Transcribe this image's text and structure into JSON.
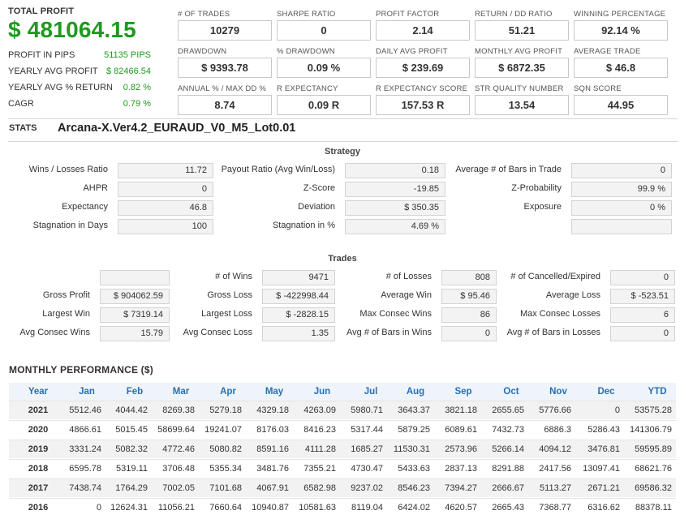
{
  "summary": {
    "total_profit_label": "TOTAL PROFIT",
    "total_profit_value": "$ 481064.15",
    "rows": [
      {
        "label": "PROFIT IN PIPS",
        "value": "51135 PIPS"
      },
      {
        "label": "YEARLY AVG PROFIT",
        "value": "$ 82466.54"
      },
      {
        "label": "YEARLY AVG % RETURN",
        "value": "0.82 %"
      },
      {
        "label": "CAGR",
        "value": "0.79 %"
      }
    ]
  },
  "metrics": [
    {
      "label": "# OF TRADES",
      "value": "10279"
    },
    {
      "label": "SHARPE RATIO",
      "value": "0"
    },
    {
      "label": "PROFIT FACTOR",
      "value": "2.14"
    },
    {
      "label": "RETURN / DD RATIO",
      "value": "51.21"
    },
    {
      "label": "WINNING PERCENTAGE",
      "value": "92.14 %"
    },
    {
      "label": "DRAWDOWN",
      "value": "$ 9393.78"
    },
    {
      "label": "% DRAWDOWN",
      "value": "0.09 %"
    },
    {
      "label": "DAILY AVG PROFIT",
      "value": "$ 239.69"
    },
    {
      "label": "MONTHLY AVG PROFIT",
      "value": "$ 6872.35"
    },
    {
      "label": "AVERAGE TRADE",
      "value": "$ 46.8"
    },
    {
      "label": "ANNUAL % / MAX DD %",
      "value": "8.74"
    },
    {
      "label": "R EXPECTANCY",
      "value": "0.09 R"
    },
    {
      "label": "R EXPECTANCY SCORE",
      "value": "157.53 R"
    },
    {
      "label": "STR QUALITY NUMBER",
      "value": "13.54"
    },
    {
      "label": "SQN SCORE",
      "value": "44.95"
    }
  ],
  "stats": {
    "label": "STATS",
    "strategy_name": "Arcana-X.Ver4.2_EURAUD_V0_M5_Lot0.01"
  },
  "strategy": {
    "title": "Strategy",
    "rows": [
      [
        {
          "label": "Wins / Losses Ratio",
          "value": "11.72"
        },
        {
          "label": "Payout Ratio (Avg Win/Loss)",
          "value": "0.18"
        },
        {
          "label": "Average # of Bars in Trade",
          "value": "0"
        }
      ],
      [
        {
          "label": "AHPR",
          "value": "0"
        },
        {
          "label": "Z-Score",
          "value": "-19.85"
        },
        {
          "label": "Z-Probability",
          "value": "99.9 %"
        }
      ],
      [
        {
          "label": "Expectancy",
          "value": "46.8"
        },
        {
          "label": "Deviation",
          "value": "$ 350.35"
        },
        {
          "label": "Exposure",
          "value": "0 %"
        }
      ],
      [
        {
          "label": "Stagnation in Days",
          "value": "100"
        },
        {
          "label": "Stagnation in %",
          "value": "4.69 %"
        },
        {
          "label": "",
          "value": ""
        }
      ]
    ]
  },
  "trades": {
    "title": "Trades",
    "rows": [
      [
        {
          "label": "",
          "value": ""
        },
        {
          "label": "# of Wins",
          "value": "9471"
        },
        {
          "label": "# of Losses",
          "value": "808"
        },
        {
          "label": "# of Cancelled/Expired",
          "value": "0"
        }
      ],
      [
        {
          "label": "Gross Profit",
          "value": "$ 904062.59"
        },
        {
          "label": "Gross Loss",
          "value": "$ -422998.44"
        },
        {
          "label": "Average Win",
          "value": "$ 95.46"
        },
        {
          "label": "Average Loss",
          "value": "$ -523.51"
        }
      ],
      [
        {
          "label": "Largest Win",
          "value": "$ 7319.14"
        },
        {
          "label": "Largest Loss",
          "value": "$ -2828.15"
        },
        {
          "label": "Max Consec Wins",
          "value": "86"
        },
        {
          "label": "Max Consec Losses",
          "value": "6"
        }
      ],
      [
        {
          "label": "Avg Consec Wins",
          "value": "15.79"
        },
        {
          "label": "Avg Consec Loss",
          "value": "1.35"
        },
        {
          "label": "Avg # of Bars in Wins",
          "value": "0"
        },
        {
          "label": "Avg # of Bars in Losses",
          "value": "0"
        }
      ]
    ]
  },
  "monthly": {
    "title": "MONTHLY PERFORMANCE ($)",
    "headers": [
      "Year",
      "Jan",
      "Feb",
      "Mar",
      "Apr",
      "May",
      "Jun",
      "Jul",
      "Aug",
      "Sep",
      "Oct",
      "Nov",
      "Dec",
      "YTD"
    ],
    "rows": [
      [
        "2021",
        "5512.46",
        "4044.42",
        "8269.38",
        "5279.18",
        "4329.18",
        "4263.09",
        "5980.71",
        "3643.37",
        "3821.18",
        "2655.65",
        "5776.66",
        "0",
        "53575.28"
      ],
      [
        "2020",
        "4866.61",
        "5015.45",
        "58699.64",
        "19241.07",
        "8176.03",
        "8416.23",
        "5317.44",
        "5879.25",
        "6089.61",
        "7432.73",
        "6886.3",
        "5286.43",
        "141306.79"
      ],
      [
        "2019",
        "3331.24",
        "5082.32",
        "4772.46",
        "5080.82",
        "8591.16",
        "4111.28",
        "1685.27",
        "11530.31",
        "2573.96",
        "5266.14",
        "4094.12",
        "3476.81",
        "59595.89"
      ],
      [
        "2018",
        "6595.78",
        "5319.11",
        "3706.48",
        "5355.34",
        "3481.76",
        "7355.21",
        "4730.47",
        "5433.63",
        "2837.13",
        "8291.88",
        "2417.56",
        "13097.41",
        "68621.76"
      ],
      [
        "2017",
        "7438.74",
        "1764.29",
        "7002.05",
        "7101.68",
        "4067.91",
        "6582.98",
        "9237.02",
        "8546.23",
        "7394.27",
        "2666.67",
        "5113.27",
        "2671.21",
        "69586.32"
      ],
      [
        "2016",
        "0",
        "12624.31",
        "11056.21",
        "7660.64",
        "10940.87",
        "10581.63",
        "8119.04",
        "6424.02",
        "4620.57",
        "2665.43",
        "7368.77",
        "6316.62",
        "88378.11"
      ]
    ]
  },
  "colors": {
    "profit_green": "#1e9a1e",
    "header_blue": "#2a6fb0"
  }
}
